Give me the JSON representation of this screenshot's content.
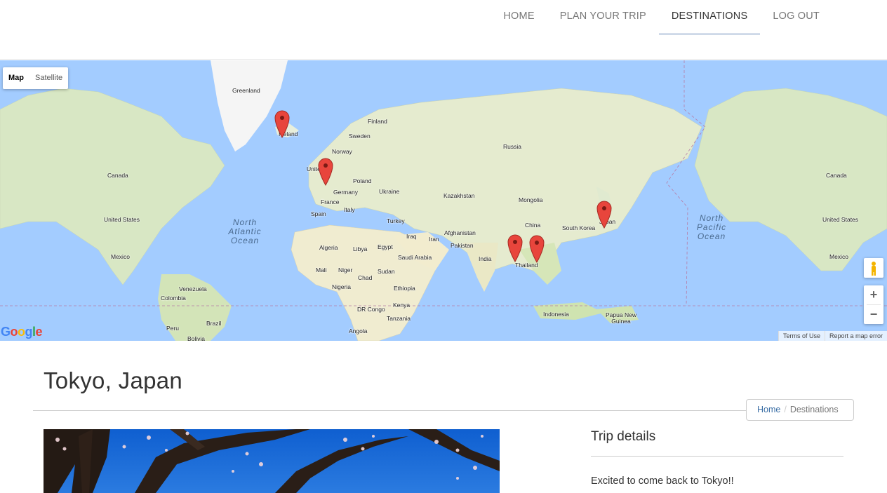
{
  "nav": {
    "items": [
      {
        "label": "HOME",
        "active": false
      },
      {
        "label": "PLAN YOUR TRIP",
        "active": false
      },
      {
        "label": "DESTINATIONS",
        "active": true
      },
      {
        "label": "LOG OUT",
        "active": false
      }
    ],
    "accent_color": "#5f82b5"
  },
  "map": {
    "type_controls": {
      "map": "Map",
      "satellite": "Satellite",
      "selected": "Map"
    },
    "country_labels": [
      "Greenland",
      "Iceland",
      "Finland",
      "Sweden",
      "Russia",
      "Norway",
      "United Kingdom",
      "Poland",
      "Canada",
      "Germany",
      "Ukraine",
      "Kazakhstan",
      "France",
      "Mongolia",
      "Italy",
      "Spain",
      "Turkey",
      "United States",
      "China",
      "South Korea",
      "Japan",
      "Afghanistan",
      "Iraq",
      "Iran",
      "Algeria",
      "Libya",
      "Egypt",
      "Pakistan",
      "Saudi Arabia",
      "India",
      "Thailand",
      "Mexico",
      "Mali",
      "Niger",
      "Sudan",
      "Chad",
      "Ethiopia",
      "Nigeria",
      "Venezuela",
      "Colombia",
      "Kenya",
      "DR Congo",
      "Indonesia",
      "Papua New Guinea",
      "Tanzania",
      "Brazil",
      "Peru",
      "Angola",
      "Bolivia"
    ],
    "ocean_labels": [
      "North Atlantic Ocean",
      "North Pacific Ocean"
    ],
    "markers": [
      "Iceland",
      "United Kingdom",
      "Thailand",
      "Vietnam",
      "Japan"
    ],
    "terms": "Terms of Use",
    "report": "Report a map error",
    "logo": "Google"
  },
  "page": {
    "title": "Tokyo, Japan"
  },
  "breadcrumb": {
    "home": "Home",
    "current": "Destinations"
  },
  "trip": {
    "heading": "Trip details",
    "text": "Excited to come back to Tokyo!!"
  }
}
